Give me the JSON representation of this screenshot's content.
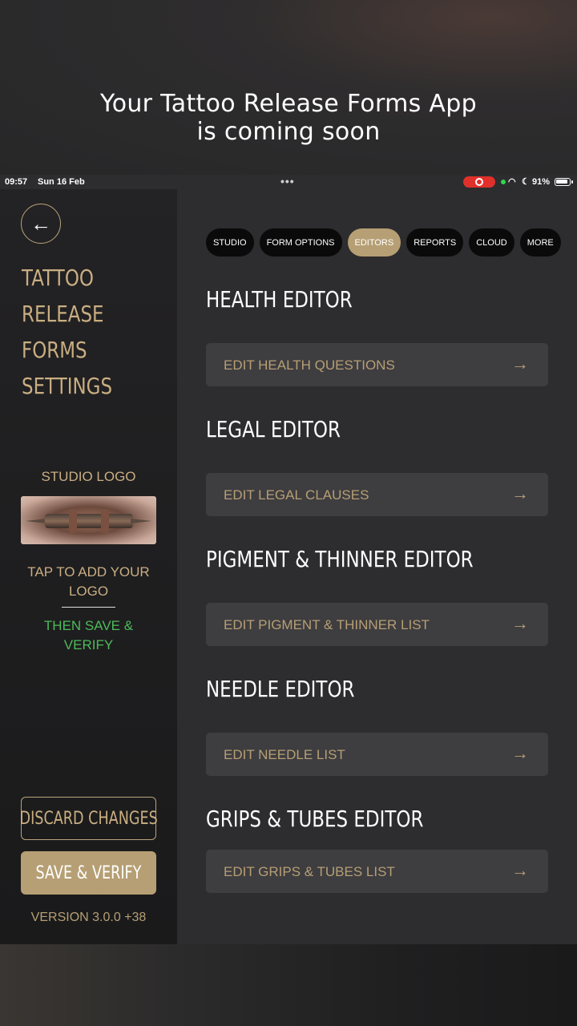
{
  "promo": {
    "line1": "Your Tattoo Release Forms App",
    "line2": "is coming soon"
  },
  "status_bar": {
    "time": "09:57",
    "date": "Sun 16 Feb",
    "battery": "91%"
  },
  "sidebar": {
    "title_lines": [
      "TATTOO",
      "RELEASE",
      "FORMS",
      "SETTINGS"
    ],
    "logo_label": "STUDIO LOGO",
    "tap_logo_text": "TAP TO ADD YOUR LOGO",
    "then_save_text": "THEN SAVE & VERIFY",
    "discard_label": "DISCARD CHANGES",
    "save_label": "SAVE & VERIFY",
    "version": "VERSION 3.0.0 +38"
  },
  "tabs": [
    {
      "label": "STUDIO",
      "active": false
    },
    {
      "label": "FORM OPTIONS",
      "active": false
    },
    {
      "label": "EDITORS",
      "active": true
    },
    {
      "label": "REPORTS",
      "active": false
    },
    {
      "label": "CLOUD",
      "active": false
    },
    {
      "label": "MORE",
      "active": false
    }
  ],
  "sections": [
    {
      "title": "HEALTH EDITOR",
      "button": "EDIT HEALTH QUESTIONS"
    },
    {
      "title": "LEGAL EDITOR",
      "button": "EDIT LEGAL CLAUSES"
    },
    {
      "title": "PIGMENT & THINNER EDITOR",
      "button": "EDIT PIGMENT & THINNER LIST"
    },
    {
      "title": "NEEDLE EDITOR",
      "button": "EDIT NEEDLE LIST"
    },
    {
      "title": "GRIPS & TUBES EDITOR",
      "button": "EDIT GRIPS & TUBES LIST"
    }
  ],
  "colors": {
    "accent": "#b69f74",
    "accent_text": "#c9ae82",
    "success": "#4cbb5a",
    "panel": "#2d2c2e",
    "row": "#3e3d40"
  },
  "icons": {
    "back": "arrow-left-icon",
    "row_arrow": "arrow-right-icon"
  }
}
